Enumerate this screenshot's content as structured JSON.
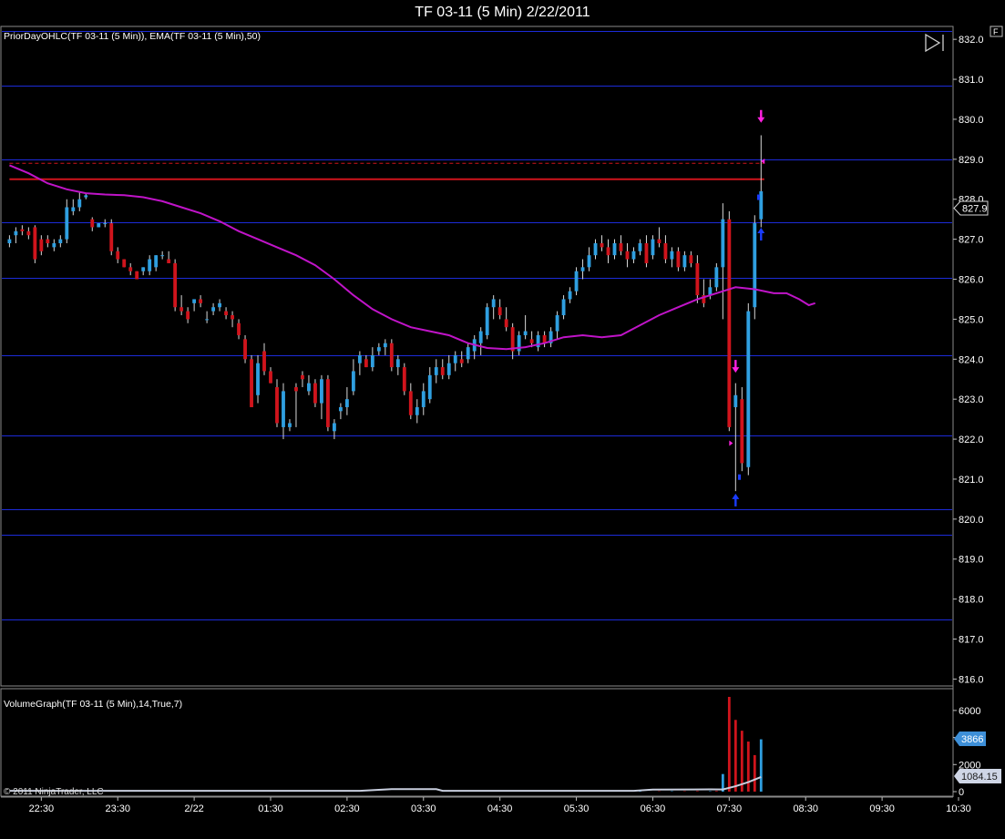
{
  "window": {
    "title": "TF 03-11 (5 Min)  2/22/2011",
    "corner_button": "F"
  },
  "price_panel": {
    "indicator_label": "PriorDayOHLC(TF 03-11 (5 Min)), EMA(TF 03-11 (5 Min),50)",
    "last_price_label": "827.9"
  },
  "volume_panel": {
    "indicator_label": "VolumeGraph(TF 03-11 (5 Min),14,True,7)",
    "last_volume_label": "3866",
    "avg_volume_label": "1084.15",
    "copyright": "© 2011 NinjaTrader, LLC"
  },
  "colors": {
    "up": "#2f9fe0",
    "down": "#d0141c",
    "ema": "#c014c8",
    "grid": "#1c2bd8",
    "prior_day": "#d0141c",
    "marker": "#ff20e0",
    "arrow_up": "#1a3cff"
  },
  "chart_data": [
    {
      "type": "candlestick",
      "title": "TF 03-11 (5 Min)  2/22/2011",
      "ylim": [
        815.85,
        832.3
      ],
      "yticks": [
        "832.0",
        "831.0",
        "830.0",
        "829.0",
        "828.0",
        "827.0",
        "826.0",
        "825.0",
        "824.0",
        "823.0",
        "822.0",
        "821.0",
        "820.0",
        "819.0",
        "818.0",
        "817.0",
        "816.0"
      ],
      "xticks": [
        "22:30",
        "23:30",
        "2/22",
        "01:30",
        "02:30",
        "03:30",
        "04:30",
        "05:30",
        "06:30",
        "07:30",
        "08:30",
        "09:30",
        "10:30"
      ],
      "xlim_bars": [
        -1.2,
        148
      ],
      "xtick_bar_positions": [
        5,
        17,
        29,
        41,
        53,
        65,
        77,
        89,
        101,
        113,
        125,
        137,
        149
      ],
      "horizontal_levels": [
        832.2,
        830.85,
        829.0,
        827.43,
        826.03,
        824.1,
        822.1,
        820.25,
        819.6,
        817.5
      ],
      "prior_day_lines": [
        {
          "style": "dashed",
          "price": 828.9
        },
        {
          "style": "solid",
          "price": 828.5
        }
      ],
      "ema": [
        [
          0,
          828.85
        ],
        [
          3,
          828.65
        ],
        [
          6,
          828.4
        ],
        [
          9,
          828.25
        ],
        [
          12,
          828.15
        ],
        [
          15,
          828.12
        ],
        [
          18,
          828.1
        ],
        [
          21,
          828.05
        ],
        [
          24,
          827.95
        ],
        [
          27,
          827.8
        ],
        [
          30,
          827.65
        ],
        [
          33,
          827.45
        ],
        [
          36,
          827.2
        ],
        [
          39,
          827.0
        ],
        [
          42,
          826.8
        ],
        [
          45,
          826.6
        ],
        [
          48,
          826.35
        ],
        [
          51,
          826.0
        ],
        [
          54,
          825.6
        ],
        [
          57,
          825.25
        ],
        [
          60,
          825.0
        ],
        [
          63,
          824.8
        ],
        [
          66,
          824.7
        ],
        [
          69,
          824.6
        ],
        [
          72,
          824.4
        ],
        [
          75,
          824.28
        ],
        [
          78,
          824.25
        ],
        [
          81,
          824.3
        ],
        [
          84,
          824.4
        ],
        [
          87,
          824.55
        ],
        [
          90,
          824.6
        ],
        [
          93,
          824.55
        ],
        [
          96,
          824.6
        ],
        [
          99,
          824.85
        ],
        [
          102,
          825.1
        ],
        [
          105,
          825.3
        ],
        [
          108,
          825.5
        ],
        [
          111,
          825.65
        ],
        [
          114,
          825.8
        ],
        [
          117,
          825.75
        ],
        [
          120,
          825.65
        ],
        [
          122,
          825.65
        ],
        [
          124,
          825.5
        ],
        [
          125.5,
          825.35
        ],
        [
          126.5,
          825.4
        ]
      ],
      "candles": [
        [
          0,
          826.9,
          827.1,
          826.8,
          827.0
        ],
        [
          1,
          827.1,
          827.3,
          826.9,
          827.2
        ],
        [
          2,
          827.25,
          827.35,
          827.1,
          827.2
        ],
        [
          3,
          827.2,
          827.3,
          827.0,
          827.1
        ],
        [
          4,
          827.3,
          827.35,
          826.4,
          826.5
        ],
        [
          5,
          827.0,
          827.1,
          826.6,
          826.7
        ],
        [
          6,
          827.0,
          827.1,
          826.8,
          826.9
        ],
        [
          7,
          826.8,
          827.0,
          826.7,
          826.9
        ],
        [
          8,
          826.9,
          827.1,
          826.8,
          827.0
        ],
        [
          9,
          827.0,
          828.0,
          826.9,
          827.8
        ],
        [
          10,
          827.7,
          828.0,
          827.6,
          827.8
        ],
        [
          11,
          827.8,
          828.2,
          827.7,
          828.0
        ],
        [
          12,
          828.05,
          828.15,
          828.0,
          828.1
        ],
        [
          13,
          827.5,
          827.55,
          827.2,
          827.3
        ],
        [
          14,
          827.3,
          827.4,
          827.3,
          827.4
        ],
        [
          15,
          827.4,
          827.5,
          827.3,
          827.4
        ],
        [
          16,
          827.4,
          827.5,
          826.6,
          826.7
        ],
        [
          17,
          826.7,
          826.8,
          826.4,
          826.5
        ],
        [
          18,
          826.5,
          826.5,
          826.3,
          826.3
        ],
        [
          19,
          826.3,
          826.4,
          826.1,
          826.2
        ],
        [
          20,
          826.2,
          826.2,
          826.0,
          826.0
        ],
        [
          21,
          826.2,
          826.3,
          826.1,
          826.3
        ],
        [
          22,
          826.2,
          826.6,
          826.1,
          826.5
        ],
        [
          23,
          826.3,
          826.6,
          826.2,
          826.6
        ],
        [
          24,
          826.6,
          826.7,
          826.5,
          826.6
        ],
        [
          25,
          826.5,
          826.7,
          826.4,
          826.4
        ],
        [
          26,
          826.4,
          826.5,
          825.2,
          825.3
        ],
        [
          27,
          825.3,
          825.6,
          825.1,
          825.2
        ],
        [
          28,
          825.2,
          825.3,
          824.9,
          825.0
        ],
        [
          29,
          825.4,
          825.5,
          825.2,
          825.5
        ],
        [
          30,
          825.5,
          825.6,
          825.3,
          825.4
        ],
        [
          31,
          825.0,
          825.2,
          824.9,
          825.0
        ],
        [
          32,
          825.2,
          825.4,
          825.1,
          825.3
        ],
        [
          33,
          825.3,
          825.5,
          825.2,
          825.4
        ],
        [
          34,
          825.2,
          825.3,
          825.0,
          825.1
        ],
        [
          35,
          825.1,
          825.2,
          824.8,
          825.0
        ],
        [
          36,
          824.9,
          825.0,
          824.5,
          824.6
        ],
        [
          37,
          824.5,
          824.6,
          823.9,
          824.0
        ],
        [
          38,
          824.0,
          824.1,
          822.8,
          822.8
        ],
        [
          39,
          823.1,
          824.1,
          822.9,
          823.9
        ],
        [
          40,
          824.2,
          824.4,
          823.6,
          823.7
        ],
        [
          41,
          823.7,
          823.8,
          823.4,
          823.4
        ],
        [
          42,
          823.3,
          823.5,
          822.3,
          822.4
        ],
        [
          43,
          822.3,
          823.4,
          822.0,
          823.2
        ],
        [
          44,
          822.3,
          822.5,
          822.2,
          822.4
        ],
        [
          45,
          823.3,
          823.4,
          822.3,
          823.2
        ],
        [
          46,
          823.6,
          823.7,
          823.3,
          823.5
        ],
        [
          47,
          823.2,
          823.6,
          823.1,
          823.4
        ],
        [
          48,
          823.4,
          823.5,
          822.8,
          822.9
        ],
        [
          49,
          822.9,
          823.6,
          822.5,
          823.5
        ],
        [
          50,
          823.5,
          823.6,
          822.2,
          822.3
        ],
        [
          51,
          822.2,
          822.5,
          822.0,
          822.4
        ],
        [
          52,
          822.7,
          822.9,
          822.5,
          822.8
        ],
        [
          53,
          822.8,
          823.3,
          822.6,
          823.0
        ],
        [
          54,
          823.2,
          824.0,
          823.1,
          823.7
        ],
        [
          55,
          823.9,
          824.2,
          823.6,
          824.1
        ],
        [
          56,
          824.0,
          824.1,
          823.8,
          823.8
        ],
        [
          57,
          823.8,
          824.3,
          823.7,
          824.1
        ],
        [
          58,
          824.2,
          824.4,
          824.1,
          824.3
        ],
        [
          59,
          824.3,
          824.5,
          824.1,
          824.4
        ],
        [
          60,
          824.4,
          824.5,
          823.7,
          823.8
        ],
        [
          61,
          823.8,
          824.1,
          823.6,
          824.0
        ],
        [
          62,
          823.8,
          823.9,
          823.1,
          823.2
        ],
        [
          63,
          823.2,
          823.4,
          822.5,
          822.6
        ],
        [
          64,
          822.6,
          823.0,
          822.4,
          822.8
        ],
        [
          65,
          822.8,
          823.4,
          822.6,
          823.2
        ],
        [
          66,
          823.0,
          823.8,
          822.9,
          823.6
        ],
        [
          67,
          823.6,
          824.0,
          823.4,
          823.8
        ],
        [
          68,
          823.8,
          824.0,
          823.5,
          823.6
        ],
        [
          69,
          823.6,
          824.1,
          823.5,
          823.9
        ],
        [
          70,
          823.9,
          824.2,
          823.7,
          824.1
        ],
        [
          71,
          824.0,
          824.2,
          823.8,
          823.9
        ],
        [
          72,
          824.0,
          824.4,
          823.9,
          824.3
        ],
        [
          73,
          824.2,
          824.6,
          824.0,
          824.5
        ],
        [
          74,
          824.4,
          824.8,
          824.1,
          824.7
        ],
        [
          75,
          824.6,
          825.4,
          824.5,
          825.3
        ],
        [
          76,
          825.3,
          825.6,
          825.0,
          825.5
        ],
        [
          77,
          825.3,
          825.5,
          825.0,
          825.1
        ],
        [
          78,
          825.0,
          825.3,
          824.7,
          824.8
        ],
        [
          79,
          824.8,
          824.9,
          824.0,
          824.2
        ],
        [
          80,
          824.2,
          824.7,
          824.1,
          824.6
        ],
        [
          81,
          824.6,
          825.1,
          824.5,
          824.7
        ],
        [
          82,
          824.5,
          824.7,
          824.3,
          824.4
        ],
        [
          83,
          824.3,
          824.7,
          824.2,
          824.6
        ],
        [
          84,
          824.6,
          824.7,
          824.3,
          824.4
        ],
        [
          85,
          824.4,
          824.8,
          824.3,
          824.7
        ],
        [
          86,
          824.7,
          825.2,
          824.5,
          825.1
        ],
        [
          87,
          825.1,
          825.6,
          825.0,
          825.5
        ],
        [
          88,
          825.5,
          825.8,
          825.4,
          825.7
        ],
        [
          89,
          825.7,
          826.3,
          825.6,
          826.2
        ],
        [
          90,
          826.2,
          826.5,
          826.0,
          826.3
        ],
        [
          91,
          826.3,
          826.8,
          826.2,
          826.6
        ],
        [
          92,
          826.6,
          827.0,
          826.5,
          826.9
        ],
        [
          93,
          826.9,
          827.1,
          826.7,
          826.8
        ],
        [
          94,
          826.8,
          827.0,
          826.4,
          826.6
        ],
        [
          95,
          826.6,
          827.0,
          826.5,
          826.9
        ],
        [
          96,
          826.9,
          827.1,
          826.6,
          826.7
        ],
        [
          97,
          826.7,
          826.9,
          826.3,
          826.5
        ],
        [
          98,
          826.5,
          826.8,
          826.4,
          826.7
        ],
        [
          99,
          826.7,
          827.0,
          826.6,
          826.9
        ],
        [
          100,
          826.9,
          827.1,
          826.3,
          826.4
        ],
        [
          101,
          826.6,
          827.1,
          826.5,
          827.0
        ],
        [
          102,
          827.0,
          827.3,
          826.8,
          826.9
        ],
        [
          103,
          826.9,
          827.1,
          826.4,
          826.5
        ],
        [
          104,
          826.5,
          826.8,
          826.3,
          826.7
        ],
        [
          105,
          826.7,
          826.8,
          826.2,
          826.3
        ],
        [
          106,
          826.3,
          826.7,
          826.2,
          826.6
        ],
        [
          107,
          826.6,
          826.7,
          826.3,
          826.4
        ],
        [
          108,
          826.4,
          826.6,
          825.4,
          825.6
        ],
        [
          109,
          825.6,
          826.0,
          825.3,
          825.4
        ],
        [
          110,
          825.6,
          826.0,
          825.5,
          825.8
        ],
        [
          111,
          825.8,
          826.4,
          825.7,
          826.3
        ],
        [
          112,
          826.3,
          827.9,
          825.0,
          827.5
        ],
        [
          113,
          827.5,
          827.7,
          822.2,
          822.3
        ],
        [
          114,
          822.8,
          823.4,
          820.7,
          823.1
        ],
        [
          115,
          823.0,
          823.3,
          821.2,
          821.4
        ],
        [
          116,
          821.3,
          825.4,
          821.1,
          825.2
        ],
        [
          117,
          825.3,
          827.6,
          825.0,
          827.4
        ],
        [
          118,
          827.5,
          829.6,
          827.3,
          828.2
        ]
      ],
      "markers": [
        {
          "kind": "arrow_down",
          "x": 118,
          "price": 830.05
        },
        {
          "kind": "arrow_up",
          "x": 118,
          "price": 827.15
        },
        {
          "kind": "arrow_down",
          "x": 114,
          "price": 823.8
        },
        {
          "kind": "arrow_up",
          "x": 114,
          "price": 820.5
        },
        {
          "kind": "tri_left",
          "x": 118,
          "price": 828.95
        },
        {
          "kind": "tri_right",
          "x": 113,
          "price": 821.9
        },
        {
          "kind": "dot",
          "x": 117.6,
          "price": 828.05
        },
        {
          "kind": "dot",
          "x": 114.6,
          "price": 821.05
        }
      ]
    },
    {
      "type": "bar",
      "title": "VolumeGraph(TF 03-11 (5 Min),14,True,7)",
      "ylim": [
        0,
        7000
      ],
      "yticks": [
        "6000",
        "4000",
        "2000",
        "0"
      ],
      "xticks": [
        "22:30",
        "23:30",
        "2/22",
        "01:30",
        "02:30",
        "03:30",
        "04:30",
        "05:30",
        "06:30",
        "07:30",
        "08:30",
        "09:30",
        "10:30"
      ],
      "volume_bars": [
        [
          95,
          20,
          "up"
        ],
        [
          97,
          25,
          "up"
        ],
        [
          99,
          30,
          "up"
        ],
        [
          102,
          25,
          "down"
        ],
        [
          104,
          30,
          "up"
        ],
        [
          106,
          30,
          "down"
        ],
        [
          108,
          40,
          "down"
        ],
        [
          110,
          30,
          "up"
        ],
        [
          111,
          50,
          "down"
        ],
        [
          112,
          1300,
          "up"
        ],
        [
          113,
          7000,
          "down"
        ],
        [
          114,
          5300,
          "down"
        ],
        [
          115,
          4500,
          "down"
        ],
        [
          116,
          3700,
          "down"
        ],
        [
          117,
          2700,
          "down"
        ],
        [
          118,
          3866,
          "up"
        ]
      ],
      "average_line": [
        [
          0,
          60
        ],
        [
          55,
          60
        ],
        [
          60,
          180
        ],
        [
          67,
          180
        ],
        [
          68,
          60
        ],
        [
          98,
          60
        ],
        [
          101,
          150
        ],
        [
          110,
          170
        ],
        [
          112,
          160
        ],
        [
          114,
          400
        ],
        [
          116,
          700
        ],
        [
          118,
          1084.15
        ]
      ]
    }
  ]
}
